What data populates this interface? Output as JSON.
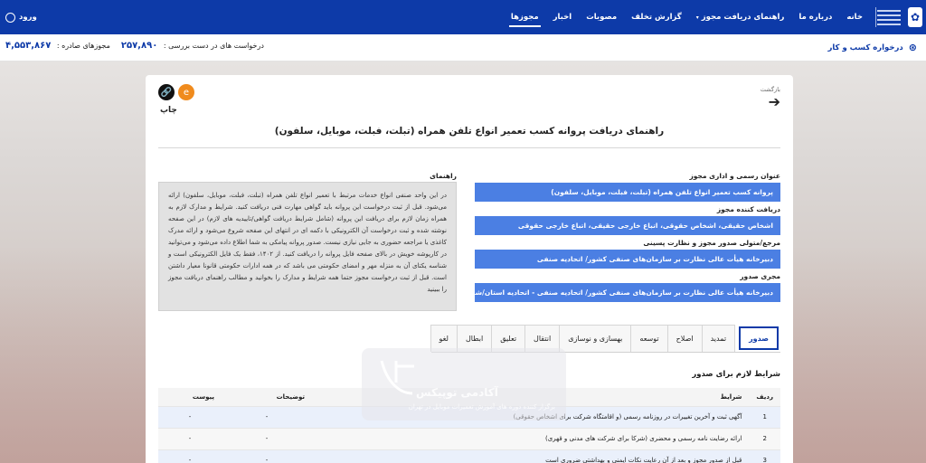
{
  "nav": {
    "items": [
      "خانه",
      "درباره ما",
      "راهنمای دریافت مجوز",
      "گزارش تخلف",
      "مصوبات",
      "اخبار",
      "مجوزها"
    ],
    "active_index": 6,
    "login": "ورود"
  },
  "infobar": {
    "breadcrumb": "درخواره کسب و کار",
    "stat1_label": "درخواست های در دست بررسی :",
    "stat1_value": "۲۵۷,۸۹۰",
    "stat2_label": "مجوزهای صادره :",
    "stat2_value": "۴,۵۵۳,۸۶۷"
  },
  "card": {
    "back_label": "بازگشت",
    "print_label": "چاپ",
    "title": "راهنمای دریافت پروانه کسب تعمیر انواع تلفن همراه (تبلت، فبلت، موبایل، سلفون)",
    "guide_title": "راهنمای",
    "guide_text": "در این واحد صنفی انواع خدمات مرتبط با تعمیر انواع تلفن همراه (تبلت، فبلت، موبایل، سلفون) ارائه می‌شود. قبل از ثبت درخواست این پروانه باید گواهی مهارت فنی دریافت کنید. شرایط و مدارک لازم به همراه زمان لازم برای دریافت این پروانه (شامل شرایط دریافت گواهی/تاییدیه های لازم) در این صفحه نوشته شده و ثبت درخواست آن الکترونیکی با دکمه ای در انتهای این صفحه شروع می‌شود و ارائه مدرک کاغذی یا مراجعه حضوری به جایی نیازی نیست. صدور پروانه پیامکی به شما اطلاع داده می‌شود و می‌توانید در کارپوشه خویش در بالای صفحه فایل پروانه را دریافت کنید. از ۱۴۰۲، فقط یک فایل الکترونیکی است و شناسه یکتای آن به منزله مهر و امضای حکومتی می باشد که در همه ادارات حکومتی قانونا معیار داشتن است. قبل از ثبت درخواست مجوز حتما همه شرایط و مدارک را بخوانید و مطالب راهنمای دریافت مجوز را ببینید",
    "fields": [
      {
        "label": "عنوان رسمی و اداری مجوز",
        "value": "پروانه کسب تعمیر انواع تلفن همراه (تبلت، فبلت، موبایل، سلفون)"
      },
      {
        "label": "دریافت کننده مجوز",
        "value": "اشخاص حقیقی، اشخاص حقوقی، اتباع خارجی حقیقی، اتباع خارجی حقوقی"
      },
      {
        "label": "مرجع/متولی صدور مجوز و نظارت پسینی",
        "value": "دبیرخانه هیأت عالی نظارت بر سازمان‌های صنفی کشور/ اتحادیه صنفی"
      },
      {
        "label": "مجری صدور",
        "value": "دبیرخانه هیأت عالی نظارت بر سازمان‌های صنفی کشور/ اتحادیه صنفی - اتحادیه استان/شهرستان"
      }
    ],
    "tabs": [
      "صدور",
      "تمدید",
      "اصلاح",
      "توسعه",
      "بهسازی و نوسازی",
      "انتقال",
      "تعلیق",
      "ابطال",
      "لغو"
    ],
    "active_tab": 0,
    "section_title": "شرایط لازم برای صدور",
    "table": {
      "headers": [
        "ردیف",
        "شرایط",
        "توضیحات",
        "پیوست"
      ],
      "rows": [
        [
          "1",
          "آگهی ثبت و آخرین تغییرات در روزنامه رسمی (و اقامتگاه شرکت برای اشخاص حقوقی)",
          "-",
          "-"
        ],
        [
          "2",
          "ارائه رضایت نامه رسمی و محضری (شرکا برای شرکت های مدنی و قهری)",
          "-",
          "-"
        ],
        [
          "3",
          "قبل از صدور مجوز و بعد از آن رعایت نکات ایمنی و بهداشتی ضروری است",
          "-",
          "-"
        ]
      ]
    }
  },
  "watermark": {
    "title": "آکادمی توپیکس",
    "subtitle": "برگزار کننده دوره های آموزش تعمیرات موبایل در تهران"
  },
  "colors": {
    "primary": "#0d3aa8",
    "field_bg": "#4b7fe3"
  }
}
